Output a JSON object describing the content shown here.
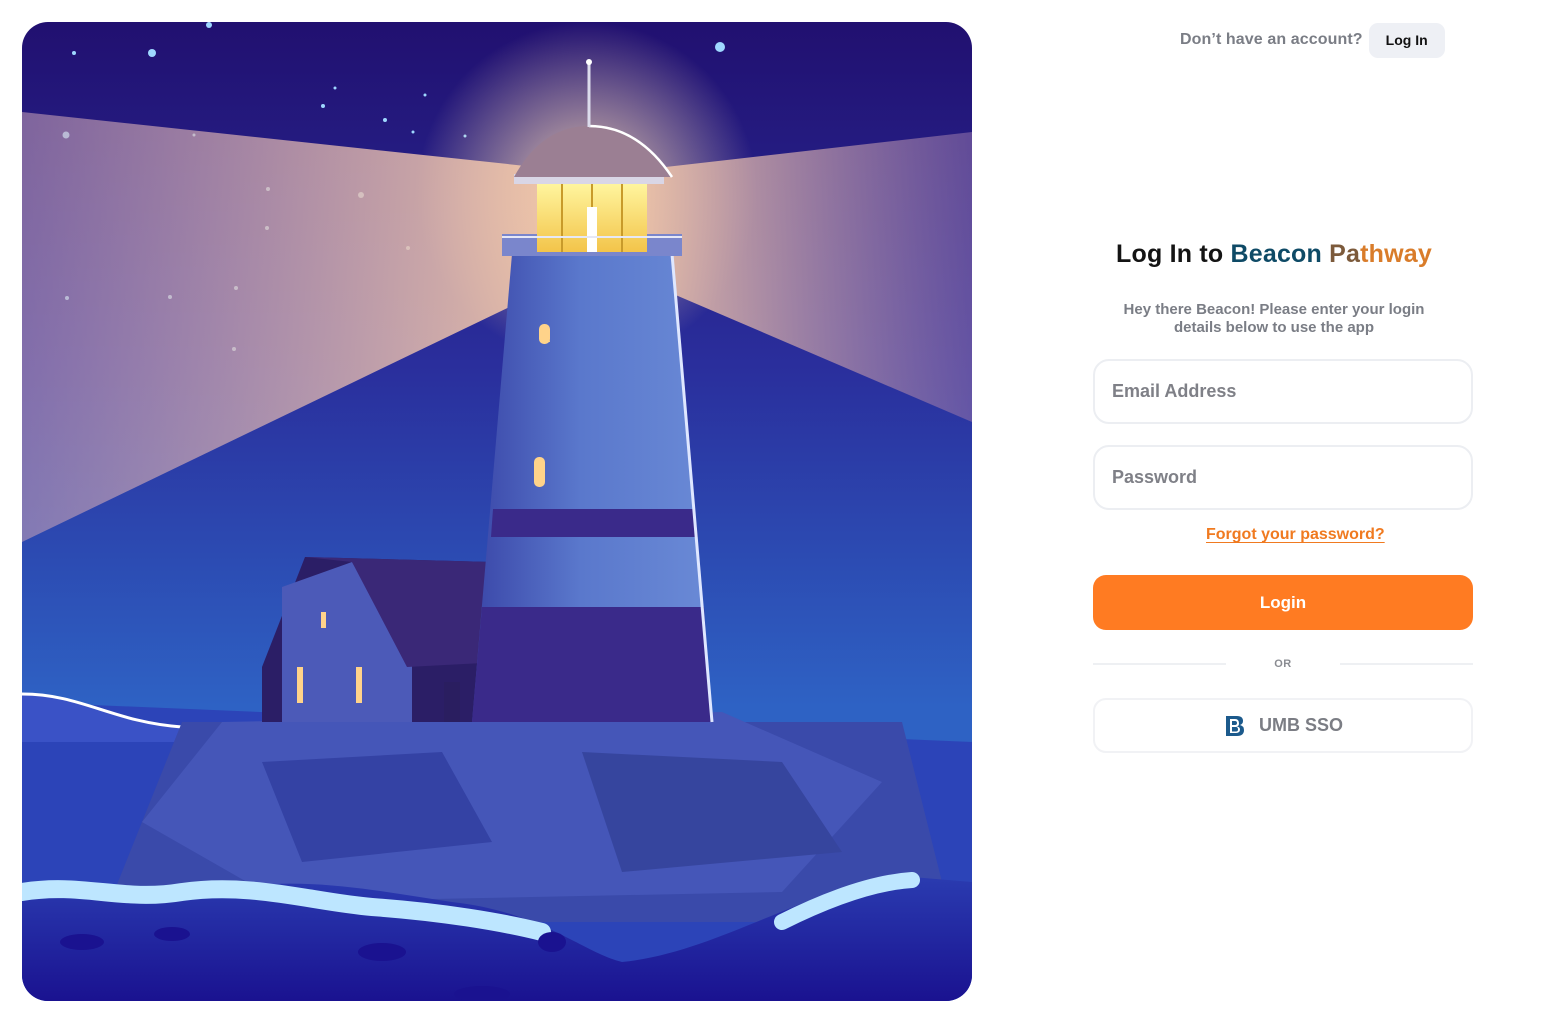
{
  "header": {
    "prompt": "Don’t have an account?",
    "login_label": "Log In"
  },
  "hero": {
    "illustration": "lighthouse-at-night"
  },
  "form": {
    "title_prefix": "Log In to ",
    "brand_part1": "Beacon",
    "brand_part2": " Pa",
    "brand_part3": "thway",
    "subtitle": "Hey there Beacon! Please enter your login details below to use the app",
    "email_placeholder": "Email Address",
    "password_placeholder": "Password",
    "forgot_label": "Forgot your password?",
    "login_button": "Login",
    "divider_label": "OR",
    "sso_label": "UMB SSO"
  },
  "colors": {
    "accent": "#ff7b22",
    "brand_teal": "#0e4a66",
    "brand_brown": "#7c5a3b",
    "brand_orange": "#d97c2a",
    "link": "#f07a20"
  }
}
